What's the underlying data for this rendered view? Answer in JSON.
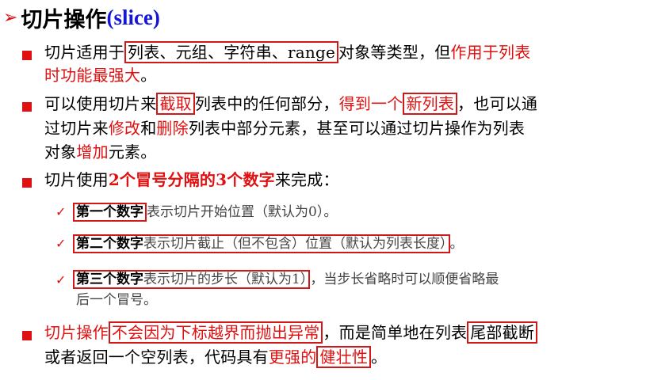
{
  "title": {
    "arrow": "➢",
    "cn": "切片操作",
    "open": "(",
    "en": "slice",
    "close": ")"
  },
  "p1": {
    "a": "切片适用于",
    "boxed": "列表、元组、字符串、range",
    "b": "对象等类型，但",
    "c": "作用于列表",
    "d": "时功能最强大",
    "e": "。"
  },
  "p2": {
    "a": "可以使用切片来",
    "jiequ": "截取",
    "b": "列表中的任何部分，",
    "c": "得到一个",
    "xinliebiao": "新列表",
    "d": "，也可以通",
    "e": "过切片来",
    "xiugai": "修改",
    "f": "和",
    "shanchu": "删除",
    "g": "列表中部分元素，甚至可以通过切片操作为列表",
    "h": "对象",
    "zengjia": "增加",
    "i": "元素。"
  },
  "p3": {
    "a": "切片使用",
    "b": "2个冒号分隔的3个数字",
    "c": "来完成："
  },
  "s1": {
    "check": "✓",
    "boxed_label": "第一个数字",
    "text": "表示切片开始位置（默认为0）",
    "after": "。"
  },
  "s2": {
    "check": "✓",
    "boxed_label": "第二个数字",
    "text": "表示切片截止（但不包含）位置（默认为列表长度）",
    "after": "。"
  },
  "s3": {
    "check": "✓",
    "boxed_label": "第三个数字",
    "text": "表示切片的步长（默认为1）",
    "after": "，当步长省略时可以顺便省略最",
    "cont": "后一个冒号。"
  },
  "p4": {
    "a": "切片操作",
    "boxed_red": "不会因为下标越界而抛出异常",
    "b": "，而是简单地在列表",
    "boxed_tail": "尾部截断",
    "c": "或者返回一个空列表，代码具有",
    "d": "更强的",
    "boxed_robust": "健壮性",
    "e": "。"
  }
}
